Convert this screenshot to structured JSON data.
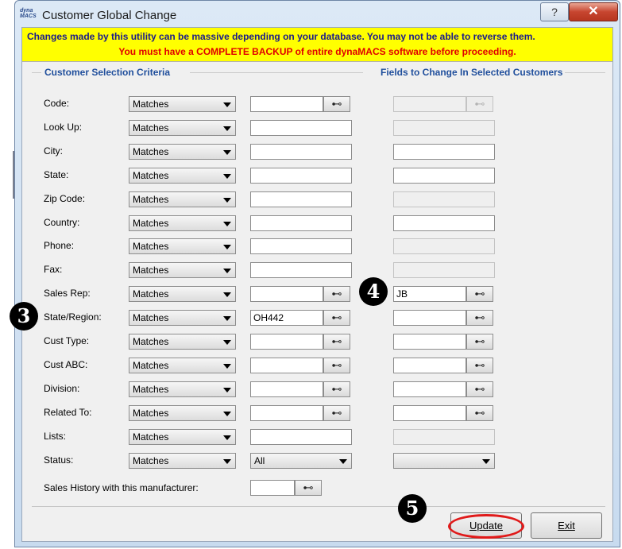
{
  "window": {
    "title": "Customer Global Change",
    "app_icon_text": "dyna MACS",
    "help_glyph": "?",
    "close_glyph": "✕"
  },
  "warning": {
    "line1": "Changes made by this utility can be massive depending on your database. You may not be able to reverse them.",
    "line2": "You must have a COMPLETE BACKUP of entire dynaMACS software before proceeding."
  },
  "groups": {
    "criteria_title": "Customer Selection Criteria",
    "change_title": "Fields to Change In Selected Customers"
  },
  "rows": [
    {
      "label": "Code:",
      "op": "Matches",
      "value": "",
      "change": ""
    },
    {
      "label": "Look Up:",
      "op": "Matches",
      "value": "",
      "change": ""
    },
    {
      "label": "City:",
      "op": "Matches",
      "value": "",
      "change": ""
    },
    {
      "label": "State:",
      "op": "Matches",
      "value": "",
      "change": ""
    },
    {
      "label": "Zip Code:",
      "op": "Matches",
      "value": "",
      "change": ""
    },
    {
      "label": "Country:",
      "op": "Matches",
      "value": "",
      "change": ""
    },
    {
      "label": "Phone:",
      "op": "Matches",
      "value": "",
      "change": ""
    },
    {
      "label": "Fax:",
      "op": "Matches",
      "value": "",
      "change": ""
    },
    {
      "label": "Sales Rep:",
      "op": "Matches",
      "value": "",
      "change": "JB"
    },
    {
      "label": "State/Region:",
      "op": "Matches",
      "value": "OH442",
      "change": ""
    },
    {
      "label": "Cust Type:",
      "op": "Matches",
      "value": "",
      "change": ""
    },
    {
      "label": "Cust ABC:",
      "op": "Matches",
      "value": "",
      "change": ""
    },
    {
      "label": "Division:",
      "op": "Matches",
      "value": "",
      "change": ""
    },
    {
      "label": "Related To:",
      "op": "Matches",
      "value": "",
      "change": ""
    },
    {
      "label": "Lists:",
      "op": "Matches",
      "value": "",
      "change": ""
    },
    {
      "label": "Status:",
      "op": "Matches",
      "value": "All",
      "change": ""
    }
  ],
  "sales_history": {
    "label": "Sales History with this manufacturer:",
    "value": ""
  },
  "buttons": {
    "update": "Update",
    "exit": "Exit"
  },
  "callouts": {
    "c3": "3",
    "c4": "4",
    "c5": "5"
  },
  "icons": {
    "lookup": "binoculars-icon",
    "dropdown": "chevron-down-icon"
  },
  "colors": {
    "warning_bg": "#ffff00",
    "warning_line1": "#1a1a8c",
    "warning_line2": "#e00000",
    "group_title": "#1f4e9c",
    "highlight": "#e01a1a"
  }
}
